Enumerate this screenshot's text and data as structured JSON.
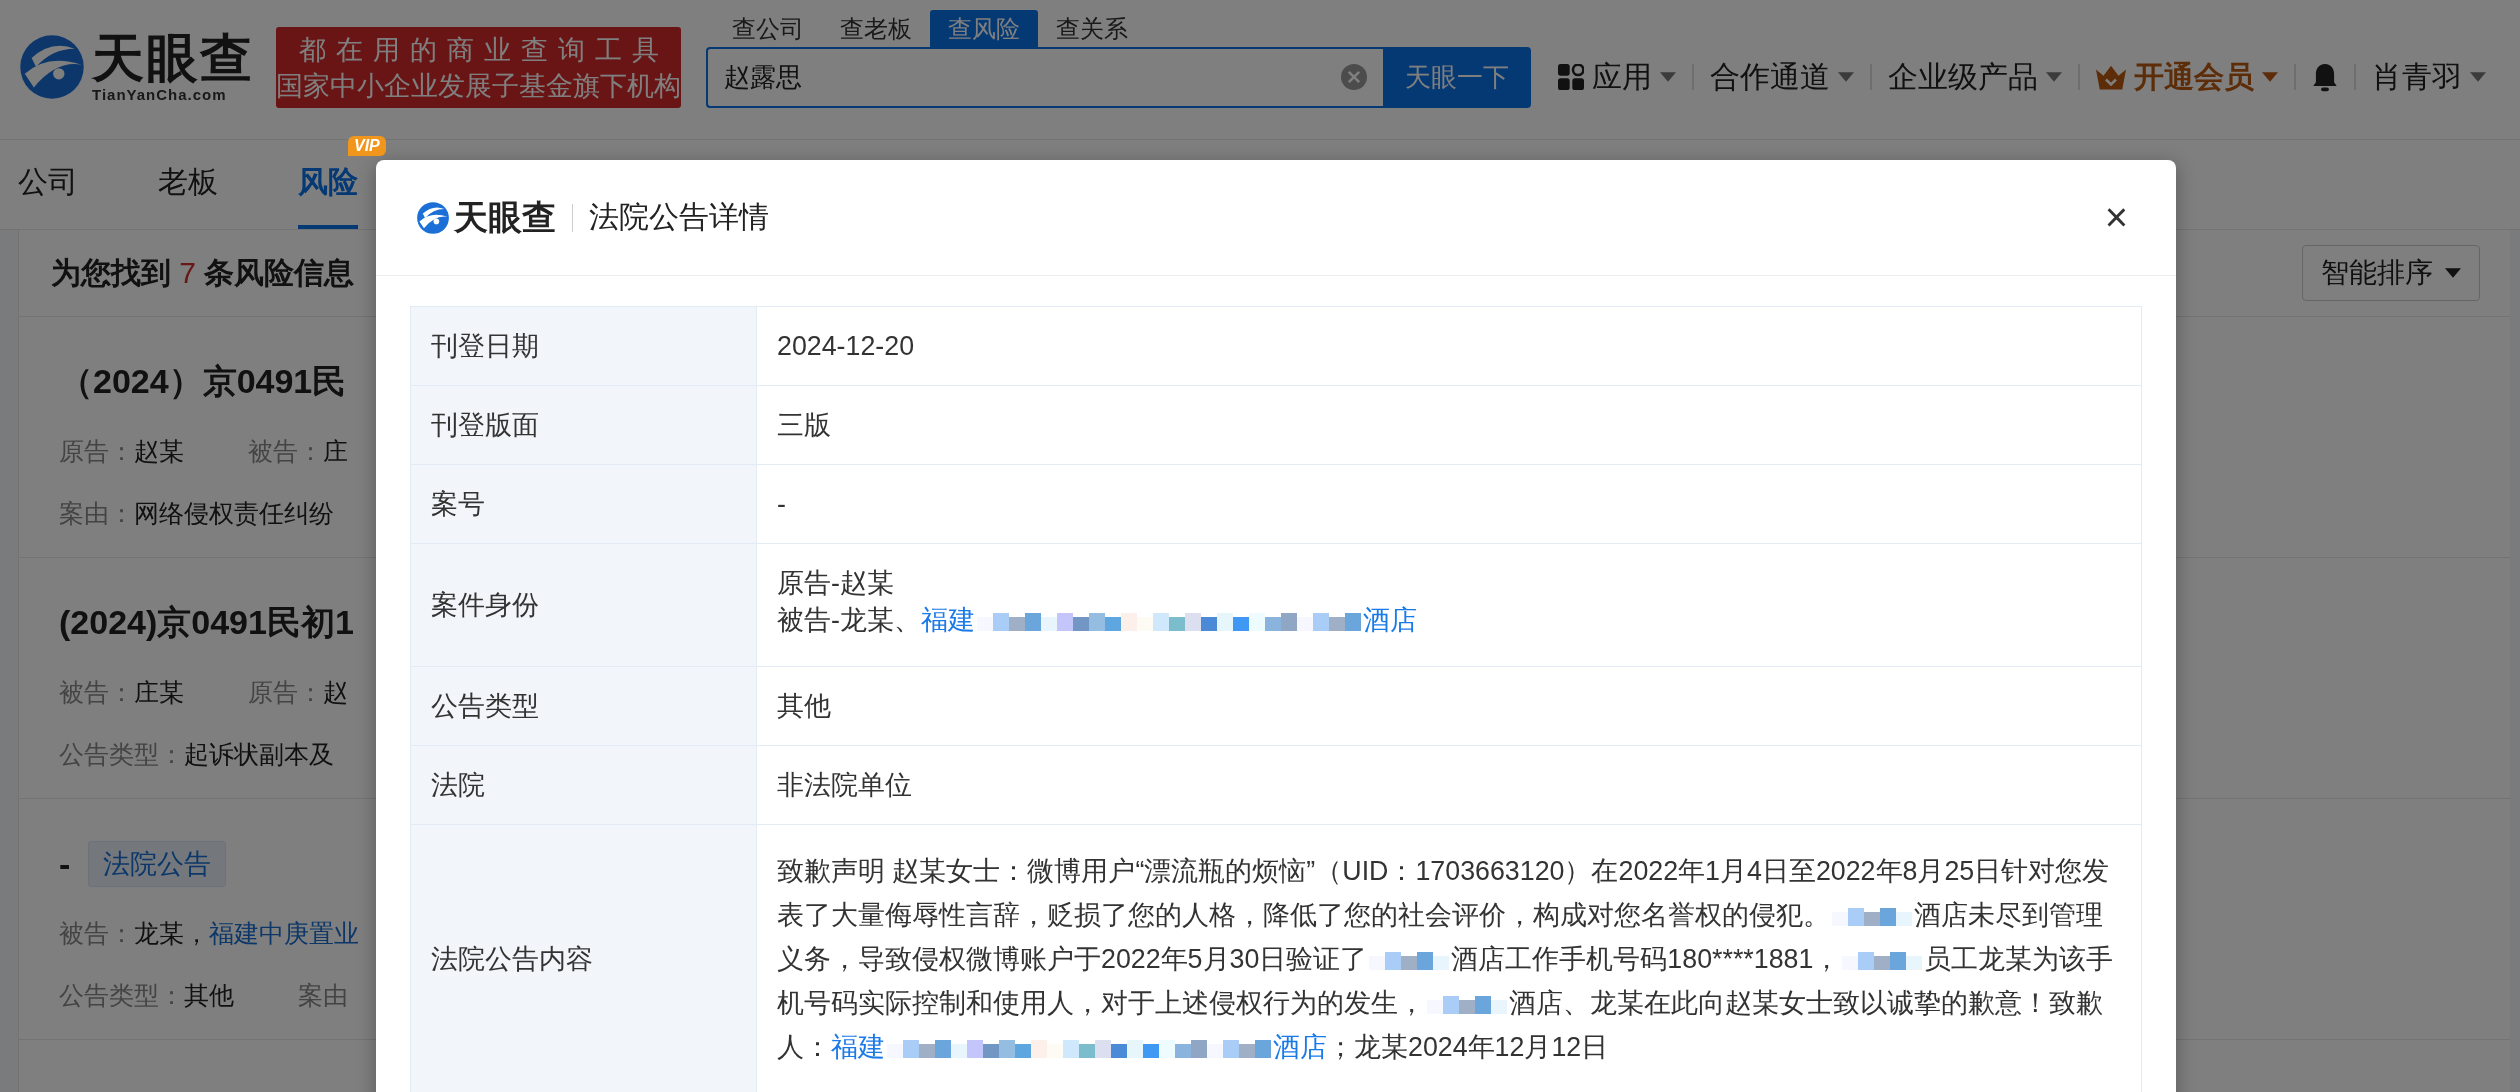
{
  "header": {
    "logo": {
      "name": "天眼查",
      "domain": "TianYanCha.com"
    },
    "banner": [
      "都在用的商业查询工具",
      "国家中小企业发展子基金旗下机构"
    ],
    "search_tabs": [
      {
        "label": "查公司",
        "selected": false
      },
      {
        "label": "查老板",
        "selected": false
      },
      {
        "label": "查风险",
        "selected": true
      },
      {
        "label": "查关系",
        "selected": false
      }
    ],
    "search": {
      "value": "赵露思",
      "button": "天眼一下"
    },
    "nav": [
      {
        "kind": "apps",
        "label": "应用"
      },
      {
        "kind": "menu",
        "label": "合作通道"
      },
      {
        "kind": "menu",
        "label": "企业级产品"
      },
      {
        "kind": "vip",
        "label": "开通会员"
      },
      {
        "kind": "bell"
      },
      {
        "kind": "menu",
        "label": "肖青羽"
      }
    ]
  },
  "tabs": [
    {
      "label": "公司",
      "selected": false
    },
    {
      "label": "老板",
      "selected": false
    },
    {
      "label": "风险",
      "selected": true,
      "badge": "VIP"
    }
  ],
  "results": {
    "summary": {
      "prefix": "为您找到",
      "count": "7",
      "suffix": "条风险信息"
    },
    "sort_button": "智能排序",
    "items": [
      {
        "title": "（2024）京0491民",
        "fields": [
          [
            {
              "label": "原告：",
              "value": "赵某"
            },
            {
              "label": "被告：",
              "value": "庄"
            }
          ],
          [
            {
              "label": "案由：",
              "value": "网络侵权责任纠纷"
            }
          ]
        ]
      },
      {
        "title": "(2024)京0491民初1",
        "fields": [
          [
            {
              "label": "被告：",
              "value": "庄某"
            },
            {
              "label": "原告：",
              "value": "赵"
            }
          ],
          [
            {
              "label": "公告类型：",
              "value": "起诉状副本及"
            }
          ]
        ]
      },
      {
        "title": "-",
        "tag": "法院公告",
        "fields": [
          [
            {
              "label": "被告：",
              "value": "龙某，",
              "link": "福建中庚置业"
            }
          ],
          [
            {
              "label": "公告类型：",
              "value": "其他"
            },
            {
              "label": "案由"
            }
          ]
        ]
      }
    ]
  },
  "modal": {
    "logo": {
      "name": "天眼查"
    },
    "title": "法院公告详情",
    "close": "×",
    "rows": [
      {
        "label": "刊登日期",
        "lines": [
          [
            {
              "kind": "text",
              "text": "2024-12-20"
            }
          ]
        ]
      },
      {
        "label": "刊登版面",
        "lines": [
          [
            {
              "kind": "text",
              "text": "三版"
            }
          ]
        ]
      },
      {
        "label": "案号",
        "lines": [
          [
            {
              "kind": "text",
              "text": "-"
            }
          ]
        ]
      },
      {
        "label": "案件身份",
        "lines": [
          [
            {
              "kind": "text",
              "text": "原告-赵某"
            }
          ],
          [
            {
              "kind": "text",
              "text": "被告-龙某、"
            },
            {
              "kind": "link",
              "text": "福建"
            },
            {
              "kind": "redacted-long"
            },
            {
              "kind": "link",
              "text": "酒店"
            }
          ]
        ]
      },
      {
        "label": "公告类型",
        "lines": [
          [
            {
              "kind": "text",
              "text": "其他"
            }
          ]
        ]
      },
      {
        "label": "法院",
        "lines": [
          [
            {
              "kind": "text",
              "text": "非法院单位"
            }
          ]
        ]
      },
      {
        "label": "法院公告内容",
        "lines": [
          [
            {
              "kind": "text",
              "text": "致歉声明 赵某女士：微博用户“漂流瓶的烦恼”（UID：1703663120）在2022年1月4日至2022年8月25日针对您发表了大量侮辱性言辞，贬损了您的人格，降低了您的社会评价，构成对您名誉权的侵犯。"
            },
            {
              "kind": "redacted-short"
            },
            {
              "kind": "text",
              "text": "酒店未尽到管理义务，导致侵权微博账户于2022年5月30日验证了"
            },
            {
              "kind": "redacted-short"
            },
            {
              "kind": "text",
              "text": "酒店工作手机号码180****1881，"
            },
            {
              "kind": "redacted-short"
            },
            {
              "kind": "text",
              "text": "员工龙某为该手机号码实际控制和使用人，对于上述侵权行为的发生，"
            },
            {
              "kind": "redacted-short"
            },
            {
              "kind": "text",
              "text": "酒店、龙某在此向赵某女士致以诚挚的歉意！致歉人："
            },
            {
              "kind": "link",
              "text": "福建"
            },
            {
              "kind": "redacted-long"
            },
            {
              "kind": "link",
              "text": "酒店"
            },
            {
              "kind": "text",
              "text": "；龙某2024年12月12日"
            }
          ]
        ]
      }
    ]
  }
}
